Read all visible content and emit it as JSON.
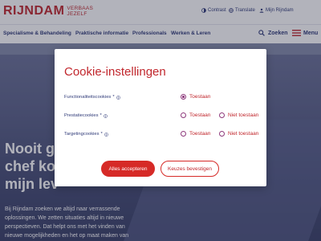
{
  "header": {
    "logo": {
      "main": "RIJNDAM",
      "sub1": "VERBAAS",
      "sub2": "JEZELF"
    },
    "utility": {
      "contrast": "Contrast",
      "translate": "Translate",
      "account": "Mijn Rijndam"
    }
  },
  "nav": {
    "items": [
      {
        "label": "Specialisme & Behandeling"
      },
      {
        "label": "Praktische informatie"
      },
      {
        "label": "Professionals"
      },
      {
        "label": "Werken & Leren"
      }
    ],
    "search": "Zoeken",
    "menu": "Menu"
  },
  "hero": {
    "title_lines": [
      "Nooit ge",
      "chef ko",
      "mijn lev"
    ],
    "text_lines": [
      "Bij Rijndam zoeken we altijd naar verrassende",
      "oplossingen. We zetten situaties altijd in nieuwe",
      "perspectieven. Dat helpt ons met het vinden van",
      "nieuwe mogelijkheden en het op maat maken van"
    ]
  },
  "cookie_modal": {
    "title": "Cookie-instellingen",
    "rows": [
      {
        "label": "Functionaliteitscookies",
        "required_mark": "*",
        "options": [
          {
            "label": "Toestaan",
            "checked": true
          }
        ]
      },
      {
        "label": "Prestatiecookies",
        "required_mark": "*",
        "options": [
          {
            "label": "Toestaan",
            "checked": false
          },
          {
            "label": "Niet toestaan",
            "checked": false
          }
        ]
      },
      {
        "label": "Targetingcookies",
        "required_mark": "*",
        "options": [
          {
            "label": "Toestaan",
            "checked": false
          },
          {
            "label": "Niet toestaan",
            "checked": false
          }
        ]
      }
    ],
    "accept_all": "Alles accepteren",
    "confirm": "Keuzes bevestigen"
  },
  "colors": {
    "brand_red": "#c1272d",
    "button_red": "#d62a27",
    "navy": "#2f3a78",
    "radio_purple": "#8e3a7c"
  }
}
